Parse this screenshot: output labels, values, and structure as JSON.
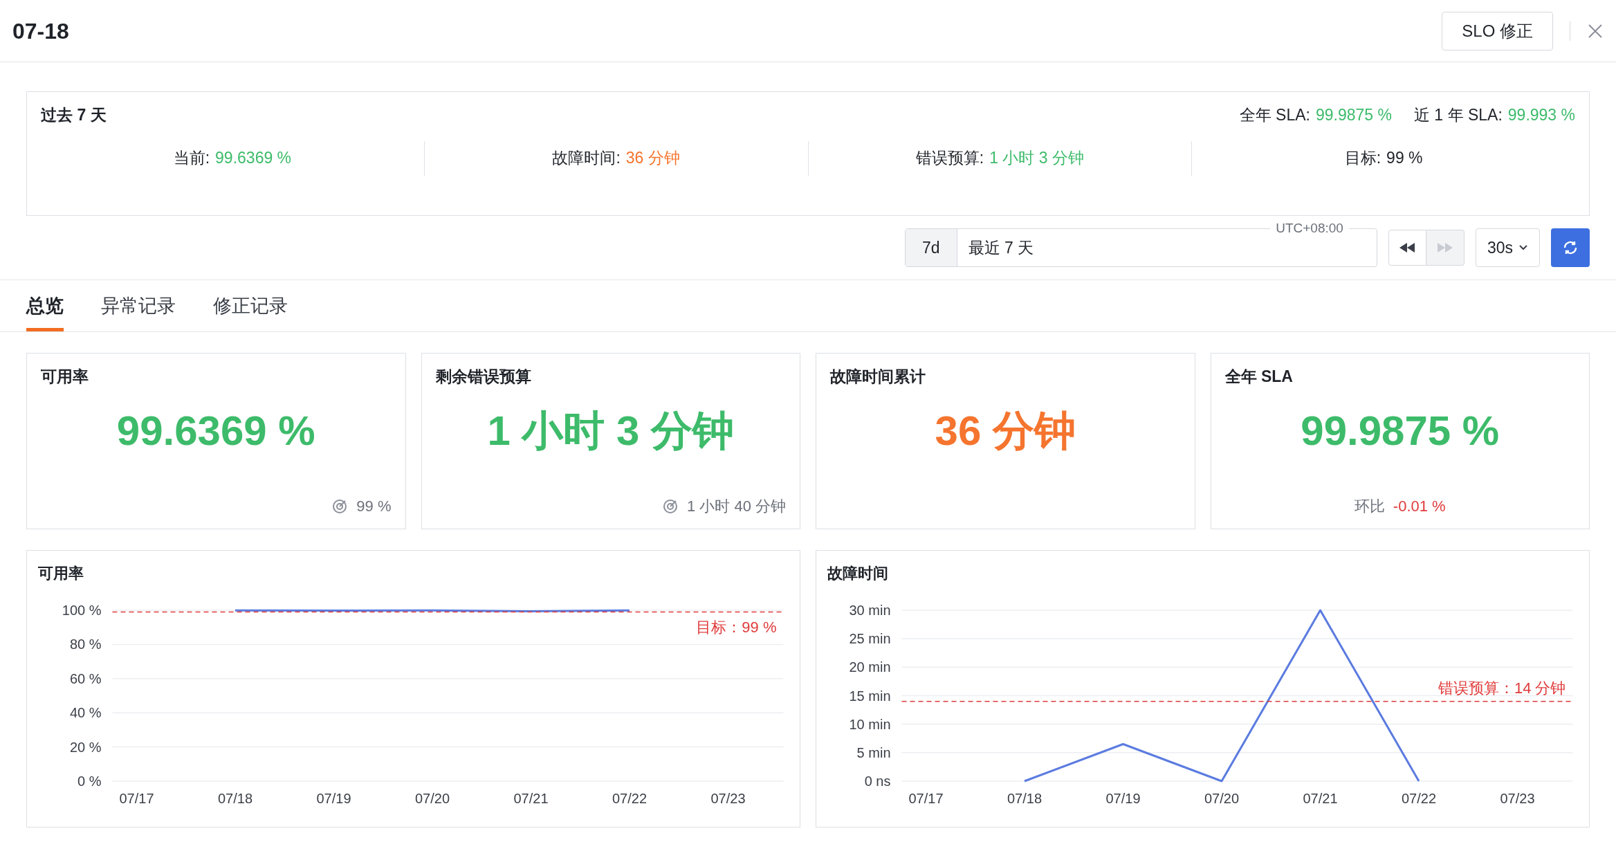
{
  "header": {
    "title": "07-18",
    "action_button": "SLO 修正"
  },
  "summary": {
    "title": "过去 7 天",
    "sla_stats": [
      {
        "label": "全年 SLA:",
        "value": "99.9875 %",
        "color": "#3dbb6a"
      },
      {
        "label": "近 1 年 SLA:",
        "value": "99.993 %",
        "color": "#3dbb6a"
      }
    ],
    "metrics": [
      {
        "label": "当前:",
        "value": "99.6369 %",
        "color": "#3dbb6a"
      },
      {
        "label": "故障时间:",
        "value": "36 分钟",
        "color": "#f5742e"
      },
      {
        "label": "错误预算:",
        "value": "1 小时 3 分钟",
        "color": "#3dbb6a"
      },
      {
        "label": "目标:",
        "value": "99 %",
        "color": "#1f2329"
      }
    ]
  },
  "time_controls": {
    "range_tag": "7d",
    "range_value": "最近 7 天",
    "timezone": "UTC+08:00",
    "rewind_disabled": false,
    "forward_disabled": true,
    "interval": "30s"
  },
  "tabs": [
    {
      "label": "总览",
      "selected": true
    },
    {
      "label": "异常记录",
      "selected": false
    },
    {
      "label": "修正记录",
      "selected": false
    }
  ],
  "cards": [
    {
      "title": "可用率",
      "value": "99.6369 %",
      "color": "#3dbb6a",
      "footer": {
        "kind": "target",
        "text": "99 %"
      }
    },
    {
      "title": "剩余错误预算",
      "value": "1 小时 3 分钟",
      "color": "#3dbb6a",
      "footer": {
        "kind": "target",
        "text": "1 小时 40 分钟"
      }
    },
    {
      "title": "故障时间累计",
      "value": "36 分钟",
      "color": "#f5742e"
    },
    {
      "title": "全年 SLA",
      "value": "99.9875 %",
      "color": "#3dbb6a",
      "footer": {
        "kind": "compare",
        "label": "环比",
        "text": "-0.01 %"
      }
    }
  ],
  "charts": [
    {
      "title": "可用率",
      "chart_data": {
        "type": "line",
        "categories": [
          "07/17",
          "07/18",
          "07/19",
          "07/20",
          "07/21",
          "07/22",
          "07/23"
        ],
        "grid": true,
        "series": [
          {
            "color": "#5b7be0",
            "values": [
              null,
              99.9,
              99.8,
              99.9,
              99.4,
              99.9,
              null
            ]
          }
        ],
        "ylim": [
          0,
          100
        ],
        "yticks": [
          {
            "value": 0,
            "label": "0 %"
          },
          {
            "value": 20,
            "label": "20 %"
          },
          {
            "value": 40,
            "label": "40 %"
          },
          {
            "value": 60,
            "label": "60 %"
          },
          {
            "value": 80,
            "label": "80 %"
          },
          {
            "value": 100,
            "label": "100 %"
          }
        ],
        "ref_lines": [
          {
            "axis": "y",
            "value": 99,
            "label": "目标：99 %",
            "color": "#e03a3a"
          }
        ]
      }
    },
    {
      "title": "故障时间",
      "chart_data": {
        "type": "line",
        "categories": [
          "07/17",
          "07/18",
          "07/19",
          "07/20",
          "07/21",
          "07/22",
          "07/23"
        ],
        "grid": true,
        "series": [
          {
            "color": "#5b7be0",
            "values": [
              null,
              0,
              6.5,
              0,
              30,
              0,
              null
            ]
          }
        ],
        "ylim": [
          0,
          30
        ],
        "yticks": [
          {
            "value": 0,
            "label": "0 ns"
          },
          {
            "value": 5,
            "label": "5 min"
          },
          {
            "value": 10,
            "label": "10 min"
          },
          {
            "value": 15,
            "label": "15 min"
          },
          {
            "value": 20,
            "label": "20 min"
          },
          {
            "value": 25,
            "label": "25 min"
          },
          {
            "value": 30,
            "label": "30 min"
          }
        ],
        "ref_lines": [
          {
            "axis": "y",
            "value": 14,
            "label": "错误预算：14 分钟",
            "color": "#e03a3a"
          }
        ]
      }
    }
  ]
}
